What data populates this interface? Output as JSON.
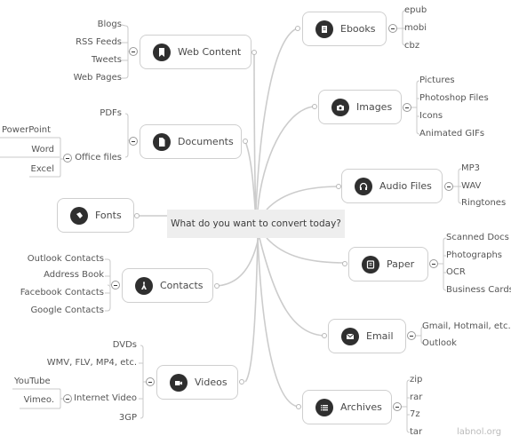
{
  "center": {
    "label": "What do you want to convert today?"
  },
  "left_branches": [
    {
      "id": "web-content",
      "label": "Web Content",
      "icon": "bookmark-icon",
      "children": [
        "Blogs",
        "RSS Feeds",
        "Tweets",
        "Web Pages"
      ]
    },
    {
      "id": "documents",
      "label": "Documents",
      "icon": "document-icon",
      "children": [
        "PDFs",
        "Office files"
      ],
      "office_files_children": [
        "PowerPoint",
        "Word",
        "Excel"
      ]
    },
    {
      "id": "fonts",
      "label": "Fonts",
      "icon": "pen-nib-icon",
      "children": []
    },
    {
      "id": "contacts",
      "label": "Contacts",
      "icon": "person-icon",
      "children": [
        "Outlook Contacts",
        "Address Book",
        "Facebook Contacts",
        "Google Contacts"
      ]
    },
    {
      "id": "videos",
      "label": "Videos",
      "icon": "video-camera-icon",
      "children": [
        "DVDs",
        "WMV, FLV, MP4, etc.",
        "Internet Video",
        "3GP"
      ],
      "internet_video_children": [
        "YouTube",
        "Vimeo."
      ]
    }
  ],
  "right_branches": [
    {
      "id": "ebooks",
      "label": "Ebooks",
      "icon": "book-icon",
      "children": [
        "epub",
        "mobi",
        "cbz"
      ]
    },
    {
      "id": "images",
      "label": "Images",
      "icon": "camera-icon",
      "children": [
        "Pictures",
        "Photoshop Files",
        "Icons",
        "Animated GIFs"
      ]
    },
    {
      "id": "audio",
      "label": "Audio Files",
      "icon": "headphones-icon",
      "children": [
        "MP3",
        "WAV",
        "Ringtones"
      ]
    },
    {
      "id": "paper",
      "label": "Paper",
      "icon": "paper-icon",
      "children": [
        "Scanned Docs",
        "Photographs",
        "OCR",
        "Business Cards"
      ]
    },
    {
      "id": "email",
      "label": "Email",
      "icon": "envelope-icon",
      "children": [
        "Gmail, Hotmail, etc.",
        "Outlook"
      ]
    },
    {
      "id": "archives",
      "label": "Archives",
      "icon": "list-icon",
      "children": [
        "zip",
        "rar",
        "7z",
        "tar"
      ]
    }
  ],
  "watermark": "labnol.org"
}
